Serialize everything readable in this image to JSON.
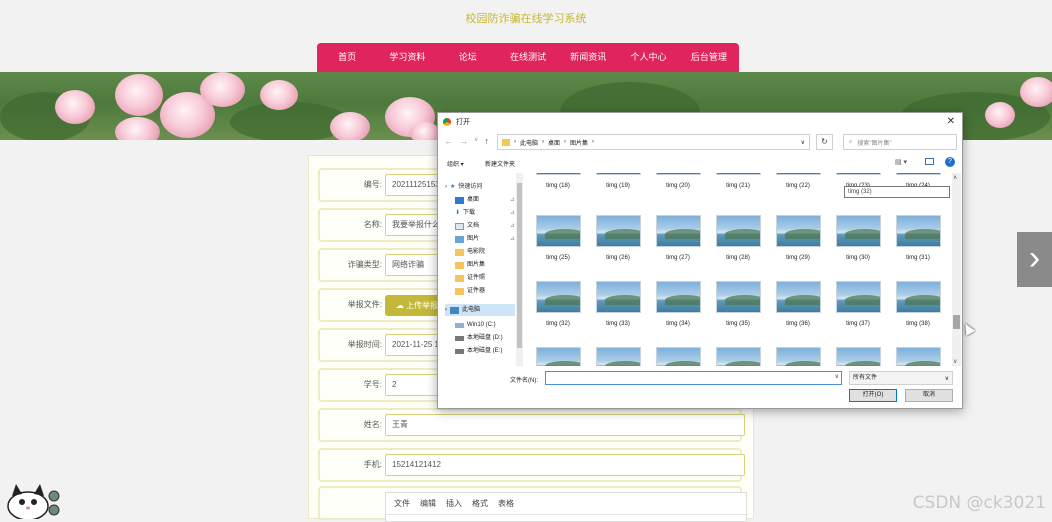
{
  "site": {
    "title": "校园防诈骗在线学习系统"
  },
  "nav": {
    "items": [
      "首页",
      "学习资料",
      "论坛",
      "在线测试",
      "新闻资讯",
      "个人中心",
      "后台管理"
    ]
  },
  "form": {
    "rows": [
      {
        "label": "编号:",
        "value": "20211125153317"
      },
      {
        "label": "名称:",
        "value": "我要举报什么什么"
      },
      {
        "label": "诈骗类型:",
        "value": "网络诈骗"
      },
      {
        "label": "举报文件:",
        "button": "上传举报文件"
      },
      {
        "label": "举报时间:",
        "value": "2021-11-25 15:33:17"
      },
      {
        "label": "学号:",
        "value": "2"
      },
      {
        "label": "姓名:",
        "value": "王青"
      },
      {
        "label": "手机:",
        "value": "15214121412"
      }
    ],
    "editor_menu": [
      "文件",
      "编辑",
      "插入",
      "格式",
      "表格"
    ]
  },
  "watermark": "CSDN @ck3021",
  "dialog": {
    "title": "打开",
    "breadcrumb": [
      "此电脑",
      "桌面",
      "图片集"
    ],
    "search_placeholder": "搜索\"图片集\"",
    "toolbar": {
      "organize": "组织 ▾",
      "new_folder": "新建文件夹"
    },
    "nav_items": [
      {
        "label": "快速访问",
        "icon": "star-icon"
      },
      {
        "label": "桌面",
        "icon": "desktop-icon"
      },
      {
        "label": "下载",
        "icon": "download-icon"
      },
      {
        "label": "文档",
        "icon": "document-icon"
      },
      {
        "label": "图片",
        "icon": "picture-icon"
      },
      {
        "label": "电影院",
        "icon": "folder-icon"
      },
      {
        "label": "图片集",
        "icon": "folder-icon"
      },
      {
        "label": "证件照",
        "icon": "folder-icon"
      },
      {
        "label": "证件器",
        "icon": "folder-icon"
      },
      {
        "label": "此电脑",
        "icon": "computer-icon"
      },
      {
        "label": "Win10 (C:)",
        "icon": "drive-icon"
      },
      {
        "label": "本地磁盘 (D:)",
        "icon": "drive-icon"
      },
      {
        "label": "本地磁盘 (E:)",
        "icon": "drive-icon"
      }
    ],
    "files_row1": [
      "timg (18)",
      "timg (19)",
      "timg (20)",
      "timg (21)",
      "timg (22)",
      "timg (23)",
      "timg (24)"
    ],
    "files_row2": [
      "timg (25)",
      "timg (26)",
      "timg (27)",
      "timg (28)",
      "timg (29)",
      "timg (30)",
      "timg (31)"
    ],
    "files_row3": [
      "timg (32)",
      "timg (33)",
      "timg (34)",
      "timg (35)",
      "timg (36)",
      "timg (37)",
      "timg (38)"
    ],
    "tooltip": "timg (32)",
    "filename_label": "文件名(N):",
    "filename_value": "",
    "filetype": "所有文件",
    "open_button": "打开(O)",
    "cancel_button": "取消"
  }
}
